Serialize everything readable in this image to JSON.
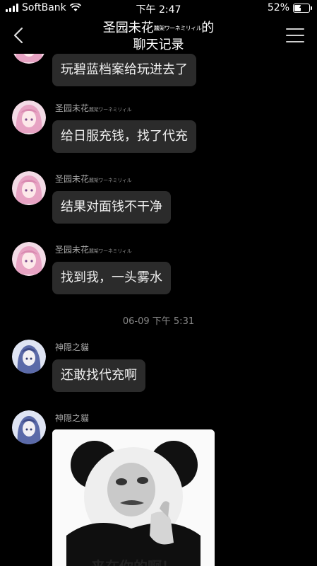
{
  "status_bar": {
    "carrier": "SoftBank",
    "time": "下午 2:47",
    "battery": "52%",
    "battery_level": 0.52,
    "icons": [
      "signal-icon",
      "wifi-icon",
      "battery-icon",
      "charging-icon"
    ]
  },
  "header": {
    "title_line1_prefix": "圣园未花",
    "title_line1_tiny": "蠶架ワーネミリィル",
    "title_line1_suffix": "的",
    "title_line2": "聊天记录",
    "icons": [
      "back-chevron-icon",
      "menu-icon"
    ]
  },
  "messages": [
    {
      "sender_prefix": "",
      "sender_tiny": "",
      "text": "玩碧蓝档案给玩进去了",
      "avatar_color": "#e7a3c3"
    },
    {
      "sender_prefix": "圣园未花",
      "sender_tiny": "蠶架ワーネミリィル",
      "text": "给日服充钱，找了代充",
      "avatar_color": "#e7a3c3"
    },
    {
      "sender_prefix": "圣园未花",
      "sender_tiny": "蠶架ワーネミリィル",
      "text": "结果对面钱不干净",
      "avatar_color": "#e7a3c3"
    },
    {
      "sender_prefix": "圣园未花",
      "sender_tiny": "蠶架ワーネミリィル",
      "text": "找到我，一头雾水",
      "avatar_color": "#e7a3c3"
    }
  ],
  "timestamp": "06-09 下午 5:31",
  "messages2": [
    {
      "sender": "神隠之貓",
      "text": "还敢找代充啊",
      "avatar_color": "#7b86c8"
    },
    {
      "sender": "神隠之貓",
      "sticker_caption": "来在你的啊！",
      "avatar_color": "#7b86c8"
    }
  ]
}
